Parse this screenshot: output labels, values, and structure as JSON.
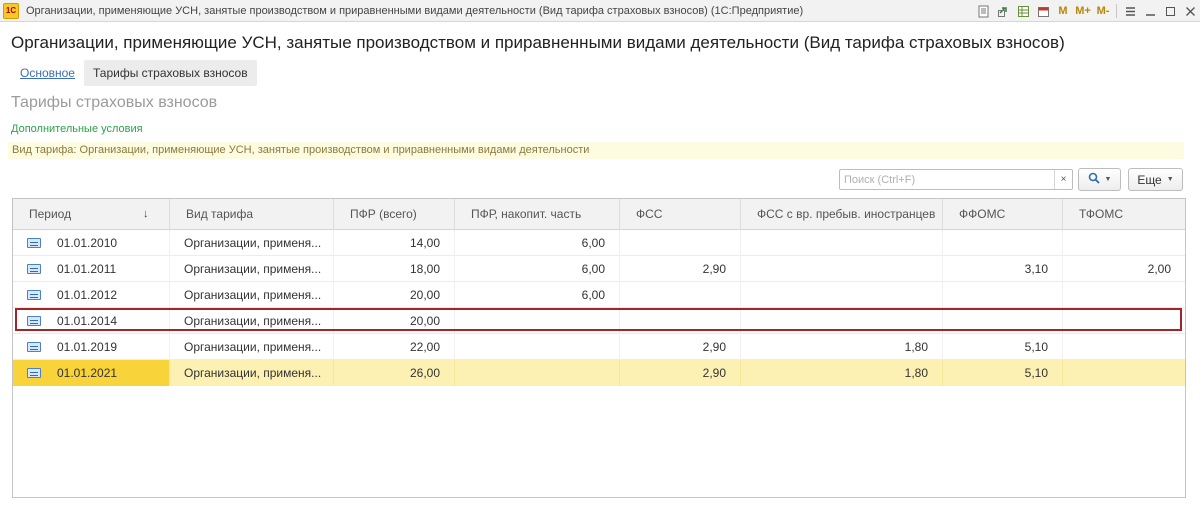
{
  "window": {
    "title": "Организации, применяющие УСН, занятые производством и приравненными видами деятельности (Вид тарифа страховых взносов)  (1С:Предприятие)",
    "logo_text": "1С",
    "memory_buttons": [
      "M",
      "M+",
      "M-"
    ]
  },
  "header": {
    "title": "Организации, применяющие УСН, занятые производством и приравненными видами деятельности (Вид тарифа страховых взносов)",
    "tabs": [
      {
        "label": "Основное"
      },
      {
        "label": "Тарифы страховых взносов"
      }
    ]
  },
  "section": {
    "title": "Тарифы страховых взносов",
    "additional_conditions": "Дополнительные условия",
    "rate_info": "Вид тарифа: Организации, применяющие УСН, занятые производством и приравненными видами деятельности"
  },
  "search": {
    "placeholder": "Поиск (Ctrl+F)",
    "value": "",
    "more_label": "Еще"
  },
  "table": {
    "columns": [
      "Период",
      "Вид тарифа",
      "ПФР (всего)",
      "ПФР, накопит. часть",
      "ФСС",
      "ФСС с вр. пребыв. иностранцев",
      "ФФОМС",
      "ТФОМС"
    ],
    "rows": [
      {
        "period": "01.01.2010",
        "type": "Организации, применя...",
        "pfr": "14,00",
        "pfr_acc": "6,00",
        "fss": "",
        "fss_foreign": "",
        "ffoms": "",
        "tfoms": ""
      },
      {
        "period": "01.01.2011",
        "type": "Организации, применя...",
        "pfr": "18,00",
        "pfr_acc": "6,00",
        "fss": "2,90",
        "fss_foreign": "",
        "ffoms": "3,10",
        "tfoms": "2,00"
      },
      {
        "period": "01.01.2012",
        "type": "Организации, применя...",
        "pfr": "20,00",
        "pfr_acc": "6,00",
        "fss": "",
        "fss_foreign": "",
        "ffoms": "",
        "tfoms": ""
      },
      {
        "period": "01.01.2014",
        "type": "Организации, применя...",
        "pfr": "20,00",
        "pfr_acc": "",
        "fss": "",
        "fss_foreign": "",
        "ffoms": "",
        "tfoms": ""
      },
      {
        "period": "01.01.2019",
        "type": "Организации, применя...",
        "pfr": "22,00",
        "pfr_acc": "",
        "fss": "2,90",
        "fss_foreign": "1,80",
        "ffoms": "5,10",
        "tfoms": ""
      },
      {
        "period": "01.01.2021",
        "type": "Организации, применя...",
        "pfr": "26,00",
        "pfr_acc": "",
        "fss": "2,90",
        "fss_foreign": "1,80",
        "ffoms": "5,10",
        "tfoms": ""
      }
    ]
  },
  "colors": {
    "selected_row": "#fcf1b3",
    "selected_cell": "#f8d339",
    "highlight_frame": "#a3242b",
    "link": "#3c6fb7",
    "green_link": "#2aa34a"
  }
}
